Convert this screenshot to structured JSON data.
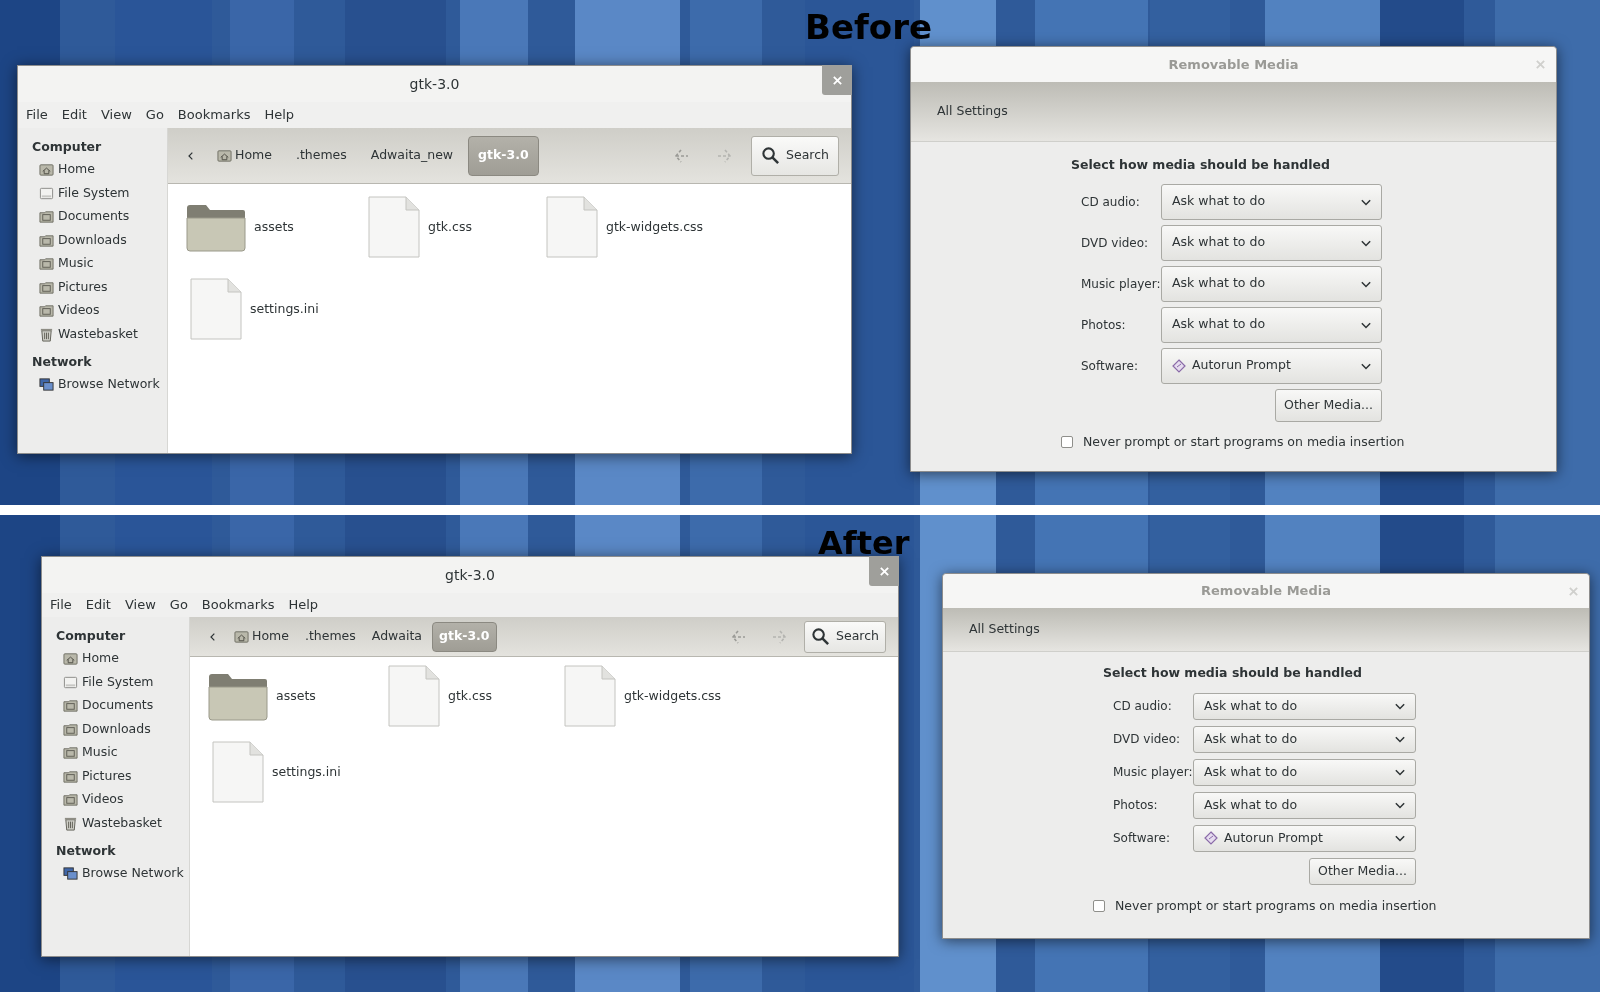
{
  "panels": [
    {
      "caption": "Before",
      "file_manager": {
        "title": "gtk-3.0",
        "menu": [
          "File",
          "Edit",
          "View",
          "Go",
          "Bookmarks",
          "Help"
        ],
        "sidebar": [
          {
            "heading": "Computer",
            "items": [
              {
                "label": "Home",
                "kind": "home"
              },
              {
                "label": "File System",
                "kind": "drive"
              },
              {
                "label": "Documents",
                "kind": "folder"
              },
              {
                "label": "Downloads",
                "kind": "folder"
              },
              {
                "label": "Music",
                "kind": "folder"
              },
              {
                "label": "Pictures",
                "kind": "folder"
              },
              {
                "label": "Videos",
                "kind": "folder"
              },
              {
                "label": "Wastebasket",
                "kind": "trash"
              }
            ]
          },
          {
            "heading": "Network",
            "items": [
              {
                "label": "Browse Network",
                "kind": "network"
              }
            ]
          }
        ],
        "path": [
          {
            "label": "Home",
            "kind": "home",
            "selected": false
          },
          {
            "label": ".themes",
            "kind": "plain",
            "selected": false
          },
          {
            "label": "Adwaita_new",
            "kind": "plain",
            "selected": false
          },
          {
            "label": "gtk-3.0",
            "kind": "plain",
            "selected": true
          }
        ],
        "search": "Search",
        "files": [
          {
            "name": "assets",
            "kind": "folder"
          },
          {
            "name": "gtk.css",
            "kind": "file"
          },
          {
            "name": "gtk-widgets.css",
            "kind": "file"
          },
          {
            "name": "settings.ini",
            "kind": "file"
          }
        ]
      },
      "settings": {
        "title": "Removable Media",
        "back": "All Settings",
        "heading": "Select how media should be handled",
        "rows": [
          {
            "label": "CD audio:",
            "value": "Ask what to do",
            "kind": "plain"
          },
          {
            "label": "DVD video:",
            "value": "Ask what to do",
            "kind": "plain"
          },
          {
            "label": "Music player:",
            "value": "Ask what to do",
            "kind": "plain"
          },
          {
            "label": "Photos:",
            "value": "Ask what to do",
            "kind": "plain"
          },
          {
            "label": "Software:",
            "value": "Autorun Prompt",
            "kind": "app"
          }
        ],
        "other_button": "Other Media...",
        "never_prompt": {
          "label": "Never prompt or start programs on media insertion",
          "checked": false
        }
      }
    },
    {
      "caption": "After",
      "file_manager": {
        "title": "gtk-3.0",
        "menu": [
          "File",
          "Edit",
          "View",
          "Go",
          "Bookmarks",
          "Help"
        ],
        "sidebar": [
          {
            "heading": "Computer",
            "items": [
              {
                "label": "Home",
                "kind": "home"
              },
              {
                "label": "File System",
                "kind": "drive"
              },
              {
                "label": "Documents",
                "kind": "folder"
              },
              {
                "label": "Downloads",
                "kind": "folder"
              },
              {
                "label": "Music",
                "kind": "folder"
              },
              {
                "label": "Pictures",
                "kind": "folder"
              },
              {
                "label": "Videos",
                "kind": "folder"
              },
              {
                "label": "Wastebasket",
                "kind": "trash"
              }
            ]
          },
          {
            "heading": "Network",
            "items": [
              {
                "label": "Browse Network",
                "kind": "network"
              }
            ]
          }
        ],
        "path": [
          {
            "label": "Home",
            "kind": "home",
            "selected": false
          },
          {
            "label": ".themes",
            "kind": "plain",
            "selected": false
          },
          {
            "label": "Adwaita",
            "kind": "plain",
            "selected": false
          },
          {
            "label": "gtk-3.0",
            "kind": "plain",
            "selected": true
          }
        ],
        "search": "Search",
        "files": [
          {
            "name": "assets",
            "kind": "folder"
          },
          {
            "name": "gtk.css",
            "kind": "file"
          },
          {
            "name": "gtk-widgets.css",
            "kind": "file"
          },
          {
            "name": "settings.ini",
            "kind": "file"
          }
        ]
      },
      "settings": {
        "title": "Removable Media",
        "back": "All Settings",
        "heading": "Select how media should be handled",
        "rows": [
          {
            "label": "CD audio:",
            "value": "Ask what to do",
            "kind": "plain"
          },
          {
            "label": "DVD video:",
            "value": "Ask what to do",
            "kind": "plain"
          },
          {
            "label": "Music player:",
            "value": "Ask what to do",
            "kind": "plain"
          },
          {
            "label": "Photos:",
            "value": "Ask what to do",
            "kind": "plain"
          },
          {
            "label": "Software:",
            "value": "Autorun Prompt",
            "kind": "app"
          }
        ],
        "other_button": "Other Media...",
        "never_prompt": {
          "label": "Never prompt or start programs on media insertion",
          "checked": false
        }
      }
    }
  ]
}
